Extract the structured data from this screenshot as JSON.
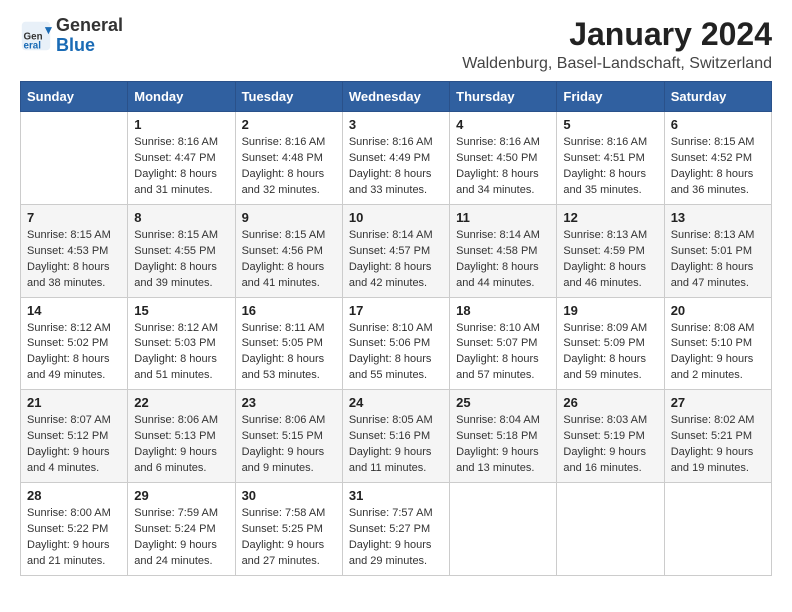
{
  "header": {
    "logo_general": "General",
    "logo_blue": "Blue",
    "month_year": "January 2024",
    "location": "Waldenburg, Basel-Landschaft, Switzerland"
  },
  "days_of_week": [
    "Sunday",
    "Monday",
    "Tuesday",
    "Wednesday",
    "Thursday",
    "Friday",
    "Saturday"
  ],
  "weeks": [
    [
      {
        "day": "",
        "info": ""
      },
      {
        "day": "1",
        "info": "Sunrise: 8:16 AM\nSunset: 4:47 PM\nDaylight: 8 hours\nand 31 minutes."
      },
      {
        "day": "2",
        "info": "Sunrise: 8:16 AM\nSunset: 4:48 PM\nDaylight: 8 hours\nand 32 minutes."
      },
      {
        "day": "3",
        "info": "Sunrise: 8:16 AM\nSunset: 4:49 PM\nDaylight: 8 hours\nand 33 minutes."
      },
      {
        "day": "4",
        "info": "Sunrise: 8:16 AM\nSunset: 4:50 PM\nDaylight: 8 hours\nand 34 minutes."
      },
      {
        "day": "5",
        "info": "Sunrise: 8:16 AM\nSunset: 4:51 PM\nDaylight: 8 hours\nand 35 minutes."
      },
      {
        "day": "6",
        "info": "Sunrise: 8:15 AM\nSunset: 4:52 PM\nDaylight: 8 hours\nand 36 minutes."
      }
    ],
    [
      {
        "day": "7",
        "info": "Sunrise: 8:15 AM\nSunset: 4:53 PM\nDaylight: 8 hours\nand 38 minutes."
      },
      {
        "day": "8",
        "info": "Sunrise: 8:15 AM\nSunset: 4:55 PM\nDaylight: 8 hours\nand 39 minutes."
      },
      {
        "day": "9",
        "info": "Sunrise: 8:15 AM\nSunset: 4:56 PM\nDaylight: 8 hours\nand 41 minutes."
      },
      {
        "day": "10",
        "info": "Sunrise: 8:14 AM\nSunset: 4:57 PM\nDaylight: 8 hours\nand 42 minutes."
      },
      {
        "day": "11",
        "info": "Sunrise: 8:14 AM\nSunset: 4:58 PM\nDaylight: 8 hours\nand 44 minutes."
      },
      {
        "day": "12",
        "info": "Sunrise: 8:13 AM\nSunset: 4:59 PM\nDaylight: 8 hours\nand 46 minutes."
      },
      {
        "day": "13",
        "info": "Sunrise: 8:13 AM\nSunset: 5:01 PM\nDaylight: 8 hours\nand 47 minutes."
      }
    ],
    [
      {
        "day": "14",
        "info": "Sunrise: 8:12 AM\nSunset: 5:02 PM\nDaylight: 8 hours\nand 49 minutes."
      },
      {
        "day": "15",
        "info": "Sunrise: 8:12 AM\nSunset: 5:03 PM\nDaylight: 8 hours\nand 51 minutes."
      },
      {
        "day": "16",
        "info": "Sunrise: 8:11 AM\nSunset: 5:05 PM\nDaylight: 8 hours\nand 53 minutes."
      },
      {
        "day": "17",
        "info": "Sunrise: 8:10 AM\nSunset: 5:06 PM\nDaylight: 8 hours\nand 55 minutes."
      },
      {
        "day": "18",
        "info": "Sunrise: 8:10 AM\nSunset: 5:07 PM\nDaylight: 8 hours\nand 57 minutes."
      },
      {
        "day": "19",
        "info": "Sunrise: 8:09 AM\nSunset: 5:09 PM\nDaylight: 8 hours\nand 59 minutes."
      },
      {
        "day": "20",
        "info": "Sunrise: 8:08 AM\nSunset: 5:10 PM\nDaylight: 9 hours\nand 2 minutes."
      }
    ],
    [
      {
        "day": "21",
        "info": "Sunrise: 8:07 AM\nSunset: 5:12 PM\nDaylight: 9 hours\nand 4 minutes."
      },
      {
        "day": "22",
        "info": "Sunrise: 8:06 AM\nSunset: 5:13 PM\nDaylight: 9 hours\nand 6 minutes."
      },
      {
        "day": "23",
        "info": "Sunrise: 8:06 AM\nSunset: 5:15 PM\nDaylight: 9 hours\nand 9 minutes."
      },
      {
        "day": "24",
        "info": "Sunrise: 8:05 AM\nSunset: 5:16 PM\nDaylight: 9 hours\nand 11 minutes."
      },
      {
        "day": "25",
        "info": "Sunrise: 8:04 AM\nSunset: 5:18 PM\nDaylight: 9 hours\nand 13 minutes."
      },
      {
        "day": "26",
        "info": "Sunrise: 8:03 AM\nSunset: 5:19 PM\nDaylight: 9 hours\nand 16 minutes."
      },
      {
        "day": "27",
        "info": "Sunrise: 8:02 AM\nSunset: 5:21 PM\nDaylight: 9 hours\nand 19 minutes."
      }
    ],
    [
      {
        "day": "28",
        "info": "Sunrise: 8:00 AM\nSunset: 5:22 PM\nDaylight: 9 hours\nand 21 minutes."
      },
      {
        "day": "29",
        "info": "Sunrise: 7:59 AM\nSunset: 5:24 PM\nDaylight: 9 hours\nand 24 minutes."
      },
      {
        "day": "30",
        "info": "Sunrise: 7:58 AM\nSunset: 5:25 PM\nDaylight: 9 hours\nand 27 minutes."
      },
      {
        "day": "31",
        "info": "Sunrise: 7:57 AM\nSunset: 5:27 PM\nDaylight: 9 hours\nand 29 minutes."
      },
      {
        "day": "",
        "info": ""
      },
      {
        "day": "",
        "info": ""
      },
      {
        "day": "",
        "info": ""
      }
    ]
  ]
}
